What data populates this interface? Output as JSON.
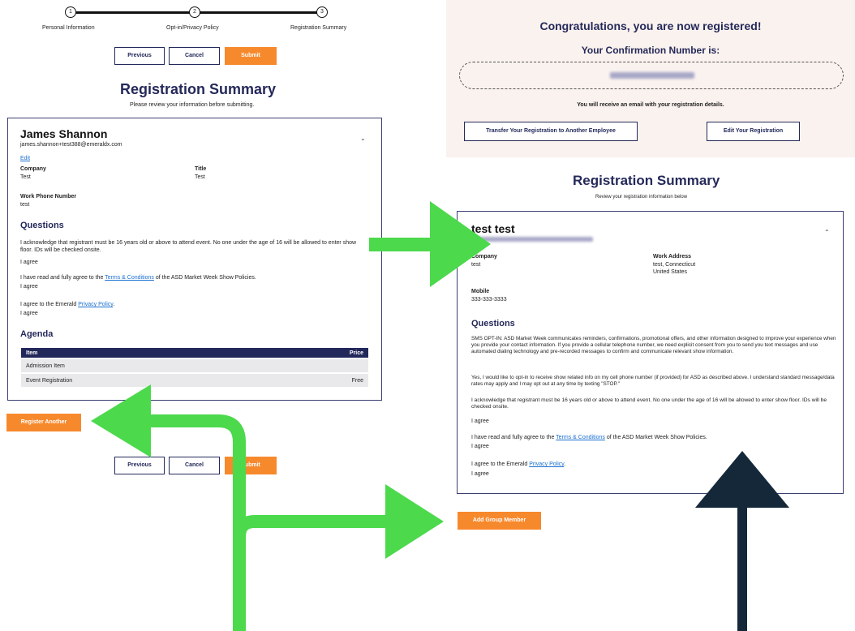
{
  "left": {
    "stepper": {
      "steps": [
        {
          "number": "1",
          "label": "Personal Information"
        },
        {
          "number": "2",
          "label": "Opt-in/Privacy Policy"
        },
        {
          "number": "3",
          "label": "Registration Summary"
        }
      ]
    },
    "nav_top": {
      "previous": "Previous",
      "cancel": "Cancel",
      "submit": "Submit"
    },
    "title": "Registration Summary",
    "subtitle": "Please review your information before submitting.",
    "attendee": {
      "name": "James Shannon",
      "email": "james.shannon+test388@emeraldx.com",
      "edit": "Edit",
      "fields": [
        {
          "label": "Company",
          "value": "Test"
        },
        {
          "label": "Title",
          "value": "Test"
        },
        {
          "label": "Work Phone Number",
          "value": "test"
        }
      ]
    },
    "questions": {
      "heading": "Questions",
      "q1": "I acknowledge that registrant must be 16 years old or above to attend event. No one under the age of 16 will be allowed to enter show floor. IDs will be checked onsite.",
      "a1": "I agree",
      "q2_pre": "I have read and fully agree to the ",
      "q2_link": "Terms & Conditions",
      "q2_post": " of the ASD Market Week Show Policies.",
      "a2": "I agree",
      "q3_pre": "I agree to the Emerald ",
      "q3_link": "Privacy Policy",
      "q3_post": ".",
      "a3": "I agree"
    },
    "agenda": {
      "heading": "Agenda",
      "col_item": "Item",
      "col_price": "Price",
      "rows": [
        {
          "item": "Admission Item",
          "price": ""
        },
        {
          "item": "Event Registration",
          "price": "Free"
        }
      ]
    },
    "register_another": "Register Another",
    "nav_bottom": {
      "previous": "Previous",
      "cancel": "Cancel",
      "submit": "Submit"
    }
  },
  "right": {
    "congrats": "Congratulations, you are now registered!",
    "confirmation_label": "Your Confirmation Number is:",
    "email_note": "You will receive an email with your registration details.",
    "transfer_button": "Transfer Your Registration to Another Employee",
    "edit_button": "Edit Your Registration",
    "title": "Registration Summary",
    "subtitle": "Review your registration information below",
    "attendee": {
      "name": "test test",
      "company_label": "Company",
      "company_value": "test",
      "address_label": "Work Address",
      "address_line1": "test, Connecticut",
      "address_line2": "United States",
      "mobile_label": "Mobile",
      "mobile_value": "333-333-3333"
    },
    "questions": {
      "heading": "Questions",
      "sms": "SMS OPT-IN: ASD Market Week communicates reminders, confirmations, promotional offers, and other information designed to improve your experience when you provide your contact information. If you provide a cellular telephone number, we need explicit consent from you to send you text messages and use automated dialing technology and pre-recorded messages to confirm and communicate relevant show information.",
      "sms_answer": "Yes, I would like to opt-in to receive show related info on my cell phone number (if provided) for ASD as described above. I understand standard message/data rates may apply and I may opt out at any time by texting \"STOP.\"",
      "q1": "I acknowledge that registrant must be 16 years old or above to attend event. No one under the age of 16 will be allowed to enter show floor. IDs will be checked onsite.",
      "a1": "I agree",
      "q2_pre": "I have read and fully agree to the ",
      "q2_link": "Terms & Conditions",
      "q2_post": " of the ASD Market Week Show Policies.",
      "a2": "I agree",
      "q3_pre": "I agree to the Emerald ",
      "q3_link": "Privacy Policy",
      "q3_post": ".",
      "a3": "I agree"
    },
    "add_group_member": "Add Group Member"
  },
  "colors": {
    "navy": "#23285a",
    "orange": "#f7892d",
    "green_arrow": "#4cd94c",
    "dark_arrow": "#14283a",
    "link": "#1a6fd0"
  }
}
